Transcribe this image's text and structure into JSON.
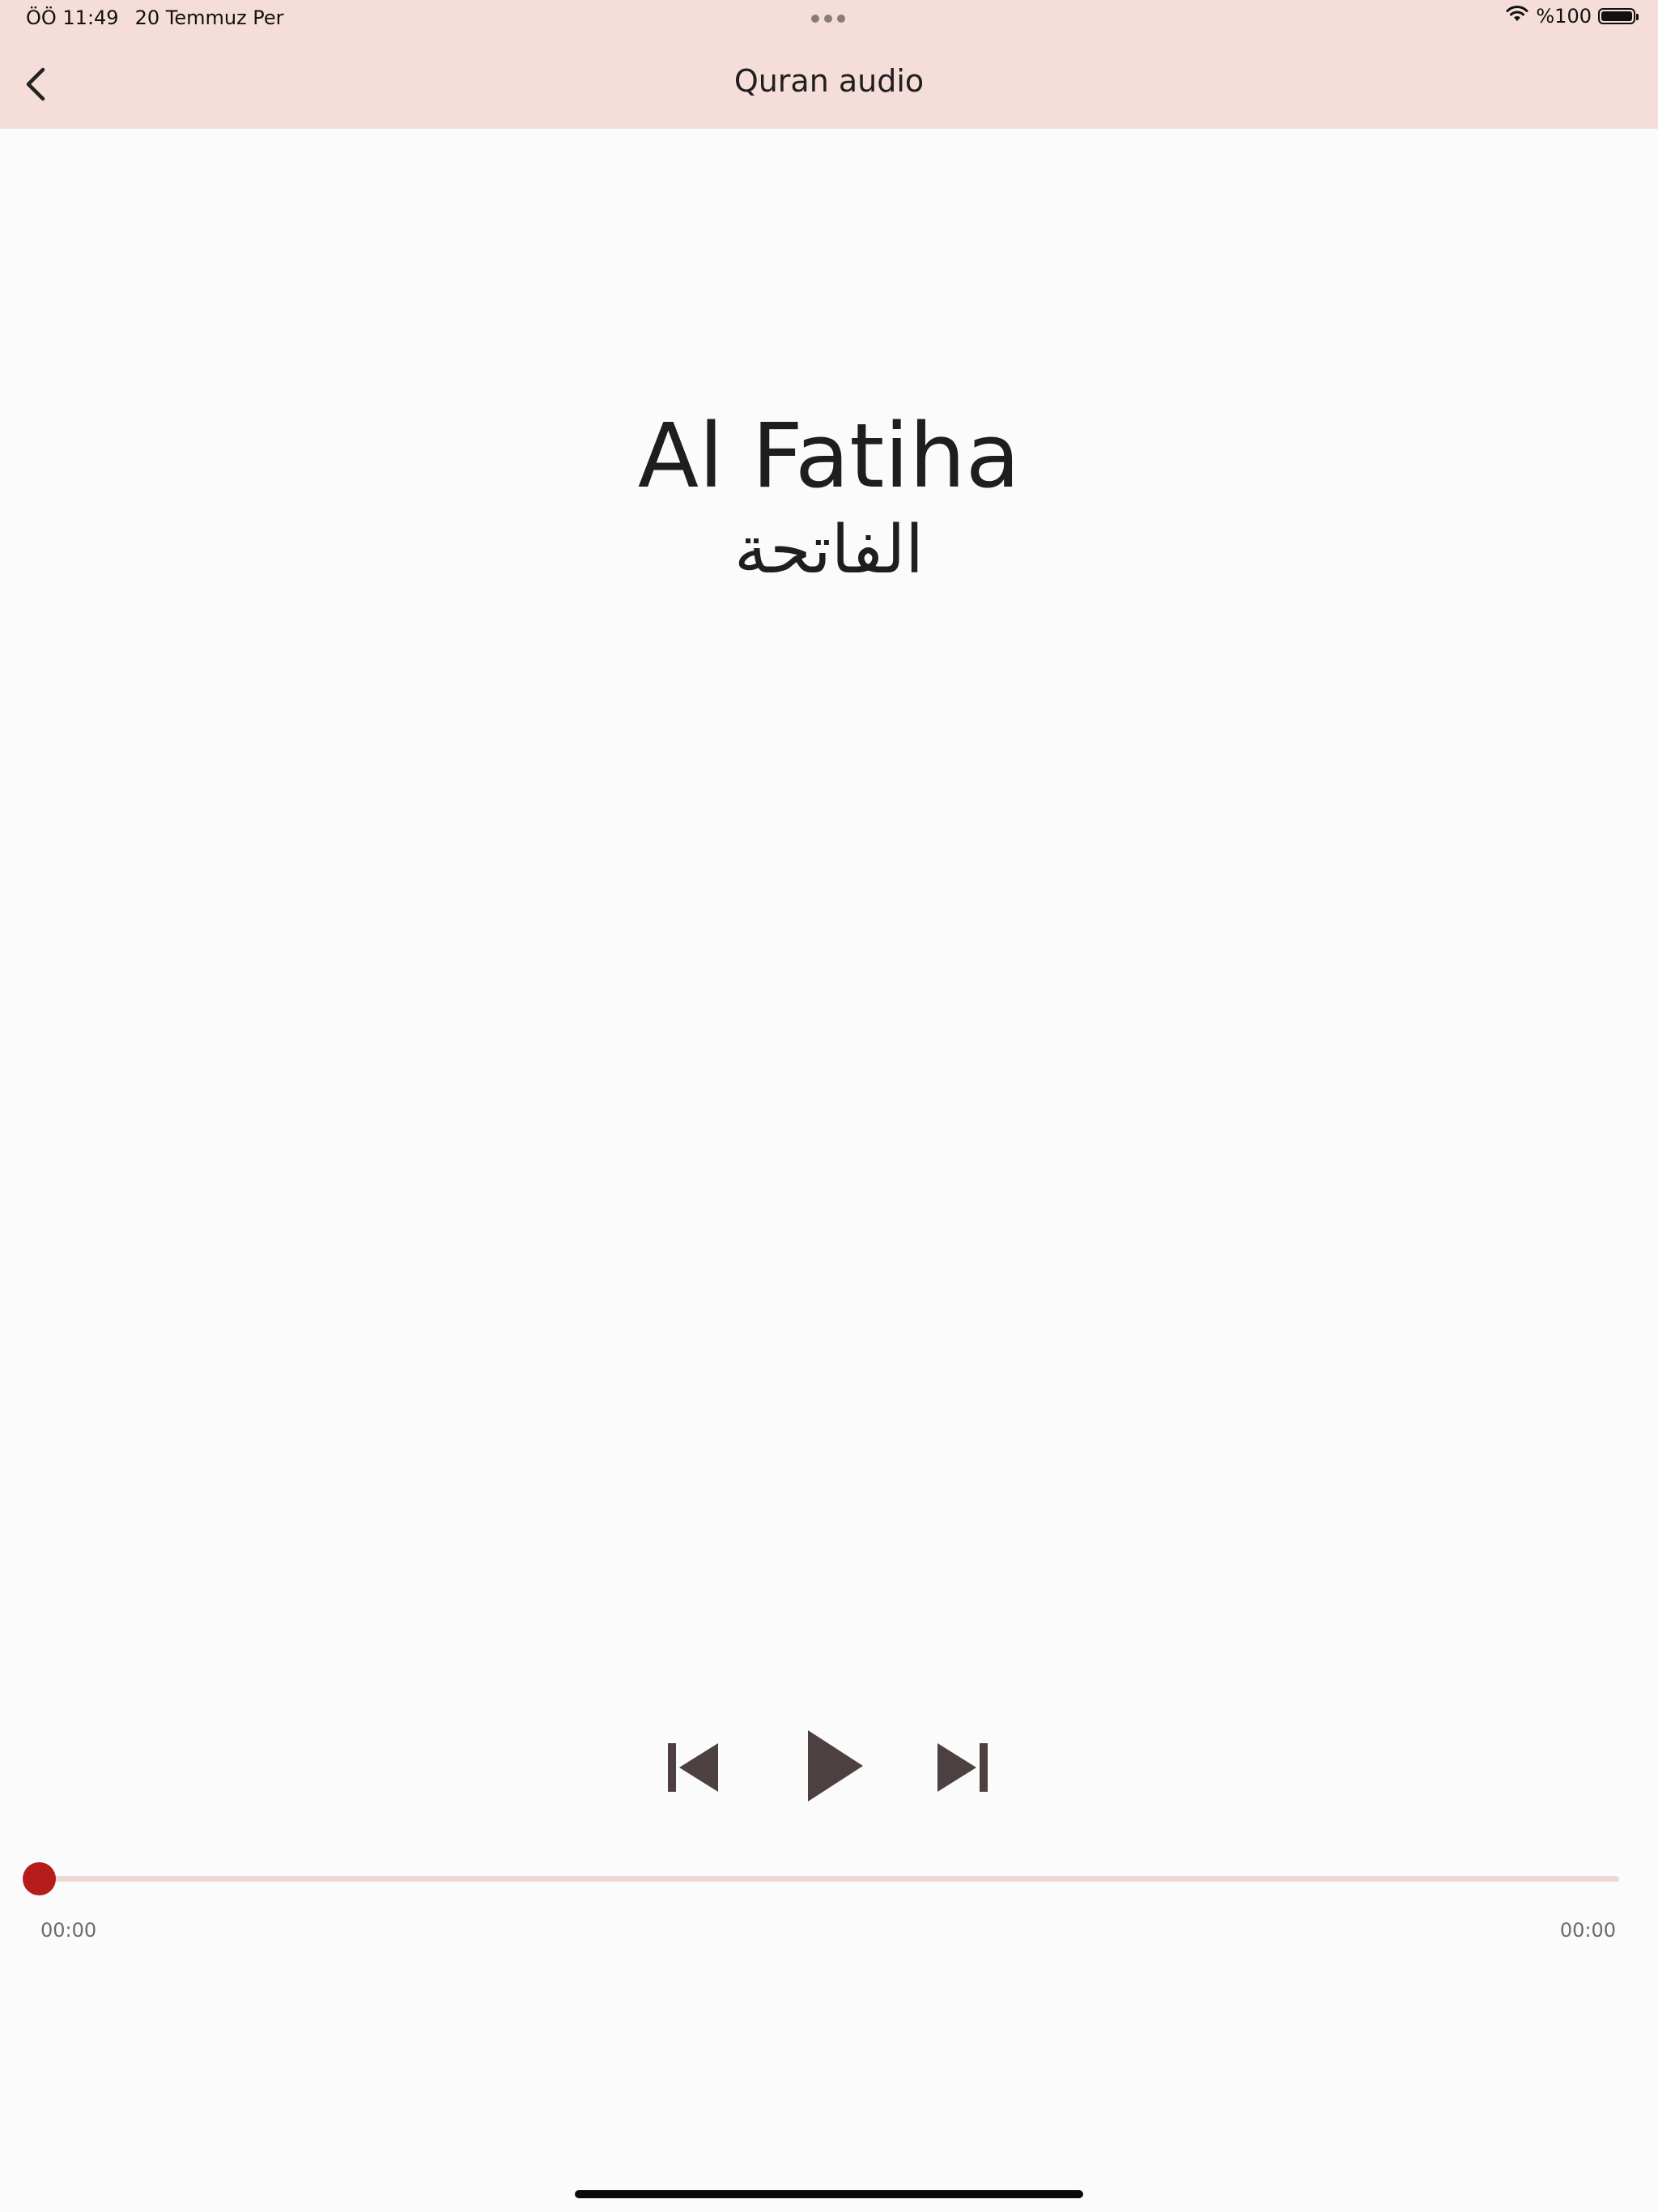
{
  "status_bar": {
    "time": "ÖÖ 11:49",
    "date": "20 Temmuz Per",
    "battery": "%100",
    "icons": [
      "wifi-icon",
      "battery-icon"
    ]
  },
  "nav": {
    "title": "Quran audio",
    "back_icon": "chevron-left-icon"
  },
  "surah": {
    "name": "Al Fatiha",
    "name_arabic": "الفاتحة"
  },
  "player": {
    "controls": [
      "skip-previous-icon",
      "play-icon",
      "skip-next-icon"
    ],
    "progress": 0,
    "position": "00:00",
    "duration": "00:00"
  },
  "colors": {
    "header_bg": "#f5ddd9",
    "accent": "#b71c1c",
    "track": "#f1d6d6",
    "controls": "#4d4040",
    "background": "#fbfbfb"
  }
}
